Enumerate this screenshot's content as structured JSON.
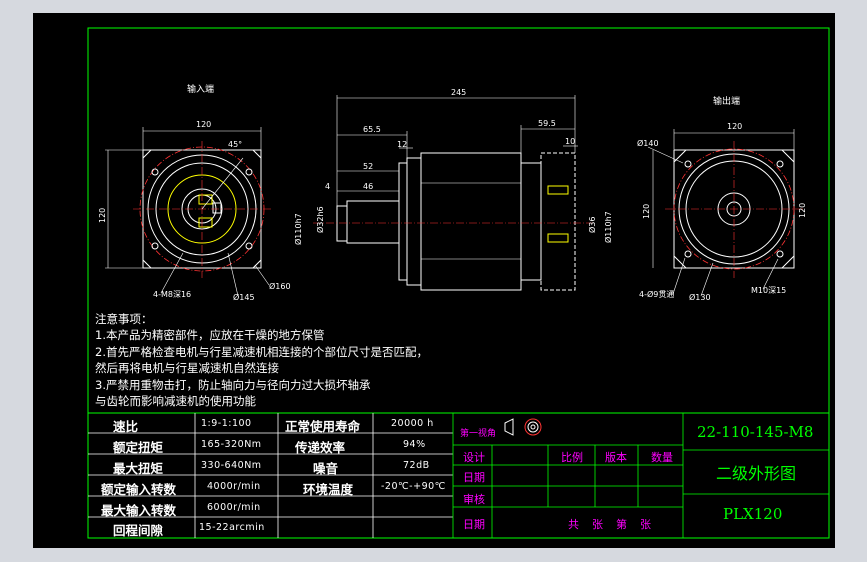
{
  "drawing": {
    "views": {
      "input_end": "输入端",
      "output_end": "输出端"
    },
    "dims": {
      "d245": "245",
      "d120a": "120",
      "d45": "45°",
      "d120b": "120",
      "d65": "65.5",
      "d12": "12",
      "d52": "52",
      "d4": "4",
      "d46": "46",
      "d59": "59.5",
      "d10": "10",
      "d110a": "Ø110h7",
      "d32": "Ø32h6",
      "d36": "Ø36",
      "d110b": "Ø110h7",
      "d120c": "120",
      "d120d": "120",
      "d140": "Ø140",
      "d130": "Ø130",
      "d160": "Ø160",
      "d145": "Ø145",
      "m8": "4-M8深16",
      "m10": "M10深15",
      "hole4": "4-Ø9贯通",
      "d120e": "120"
    },
    "notes": {
      "title": "注意事项：",
      "lines": [
        "1.本产品为精密部件，应放在干燥的地方保管",
        "2.首先严格检查电机与行星减速机相连接的个部位尺寸是否匹配，",
        "然后再将电机与行星减速机自然连接",
        "3.严禁用重物击打，防止轴向力与径向力过大损坏轴承",
        "与齿轮而影响减速机的使用功能"
      ]
    },
    "specs": [
      {
        "label": "速比",
        "value": "1:9-1:100",
        "label2": "正常使用寿命",
        "value2": "20000 h"
      },
      {
        "label": "额定扭矩",
        "value": "165-320Nm",
        "label2": "传递效率",
        "value2": "94%"
      },
      {
        "label": "最大扭矩",
        "value": "330-640Nm",
        "label2": "噪音",
        "value2": "72dB"
      },
      {
        "label": "额定输入转数",
        "value": "4000r/min",
        "label2": "环境温度",
        "value2": "-20℃-+90℃"
      },
      {
        "label": "最大输入转数",
        "value": "6000r/min",
        "label2": "",
        "value2": ""
      },
      {
        "label": "回程间隙",
        "value": "15-22arcmin",
        "label2": "",
        "value2": ""
      }
    ],
    "title_block": {
      "angle": "第一视角",
      "design": "设计",
      "date1": "日期",
      "review": "审核",
      "date2": "日期",
      "scale": "比例",
      "version": "版本",
      "qty": "数量",
      "sheets": "共　张　第　张",
      "code": "22-110-145-M8",
      "name": "二级外形图",
      "model": "PLX120"
    }
  }
}
